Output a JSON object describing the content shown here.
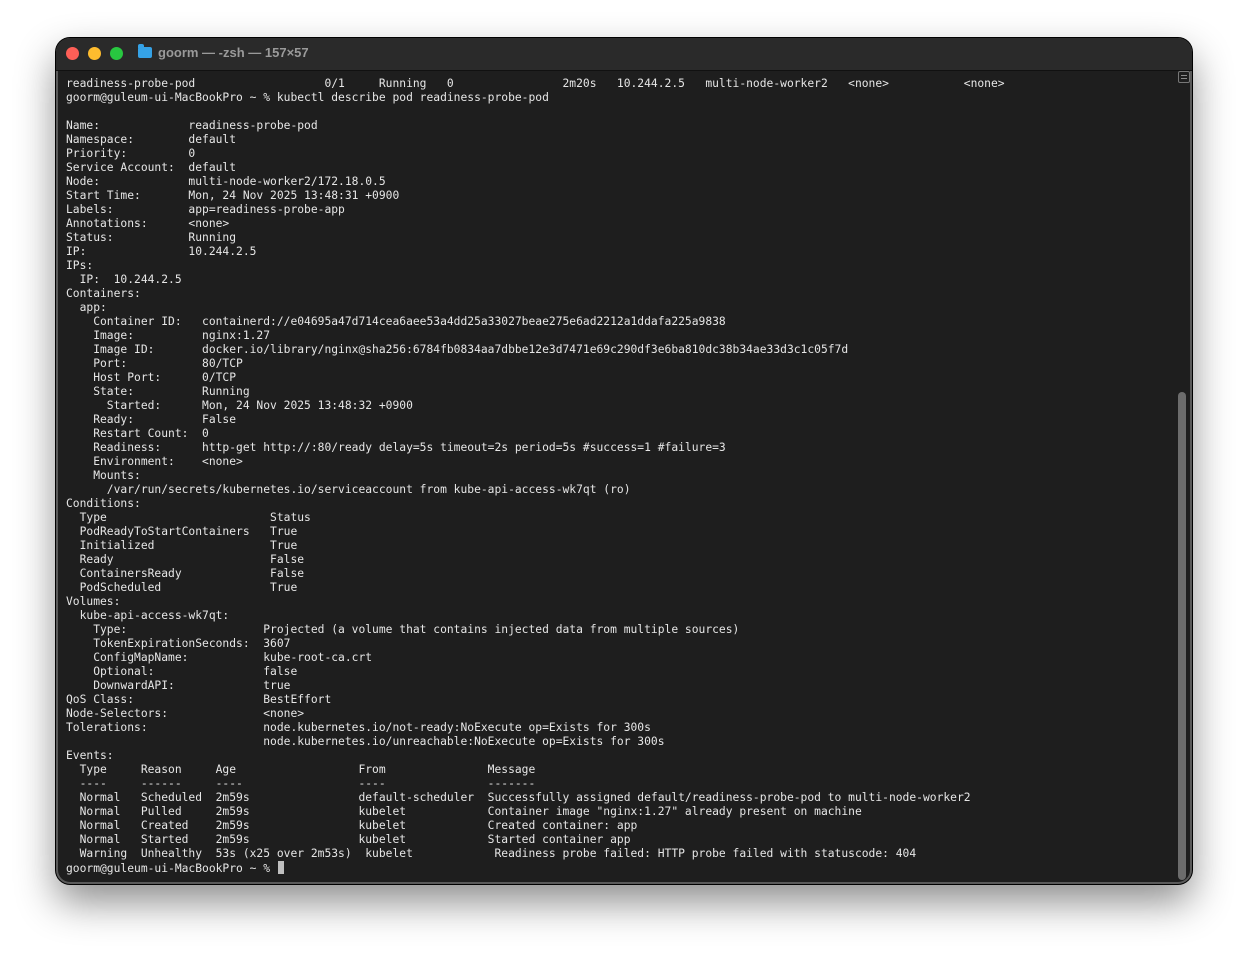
{
  "window": {
    "title": "goorm — -zsh — 157×57"
  },
  "terminal": {
    "lines": [
      "readiness-probe-pod                   0/1     Running   0                2m20s   10.244.2.5   multi-node-worker2   <none>           <none>",
      "goorm@guleum-ui-MacBookPro ~ % kubectl describe pod readiness-probe-pod",
      "",
      "Name:             readiness-probe-pod",
      "Namespace:        default",
      "Priority:         0",
      "Service Account:  default",
      "Node:             multi-node-worker2/172.18.0.5",
      "Start Time:       Mon, 24 Nov 2025 13:48:31 +0900",
      "Labels:           app=readiness-probe-app",
      "Annotations:      <none>",
      "Status:           Running",
      "IP:               10.244.2.5",
      "IPs:",
      "  IP:  10.244.2.5",
      "Containers:",
      "  app:",
      "    Container ID:   containerd://e04695a47d714cea6aee53a4dd25a33027beae275e6ad2212a1ddafa225a9838",
      "    Image:          nginx:1.27",
      "    Image ID:       docker.io/library/nginx@sha256:6784fb0834aa7dbbe12e3d7471e69c290df3e6ba810dc38b34ae33d3c1c05f7d",
      "    Port:           80/TCP",
      "    Host Port:      0/TCP",
      "    State:          Running",
      "      Started:      Mon, 24 Nov 2025 13:48:32 +0900",
      "    Ready:          False",
      "    Restart Count:  0",
      "    Readiness:      http-get http://:80/ready delay=5s timeout=2s period=5s #success=1 #failure=3",
      "    Environment:    <none>",
      "    Mounts:",
      "      /var/run/secrets/kubernetes.io/serviceaccount from kube-api-access-wk7qt (ro)",
      "Conditions:",
      "  Type                        Status",
      "  PodReadyToStartContainers   True",
      "  Initialized                 True",
      "  Ready                       False",
      "  ContainersReady             False",
      "  PodScheduled                True",
      "Volumes:",
      "  kube-api-access-wk7qt:",
      "    Type:                    Projected (a volume that contains injected data from multiple sources)",
      "    TokenExpirationSeconds:  3607",
      "    ConfigMapName:           kube-root-ca.crt",
      "    Optional:                false",
      "    DownwardAPI:             true",
      "QoS Class:                   BestEffort",
      "Node-Selectors:              <none>",
      "Tolerations:                 node.kubernetes.io/not-ready:NoExecute op=Exists for 300s",
      "                             node.kubernetes.io/unreachable:NoExecute op=Exists for 300s",
      "Events:",
      "  Type     Reason     Age                  From               Message",
      "  ----     ------     ----                 ----               -------",
      "  Normal   Scheduled  2m59s                default-scheduler  Successfully assigned default/readiness-probe-pod to multi-node-worker2",
      "  Normal   Pulled     2m59s                kubelet            Container image \"nginx:1.27\" already present on machine",
      "  Normal   Created    2m59s                kubelet            Created container: app",
      "  Normal   Started    2m59s                kubelet            Started container app",
      "  Warning  Unhealthy  53s (x25 over 2m53s)  kubelet            Readiness probe failed: HTTP probe failed with statuscode: 404"
    ],
    "prompt": "goorm@guleum-ui-MacBookPro ~ % "
  }
}
